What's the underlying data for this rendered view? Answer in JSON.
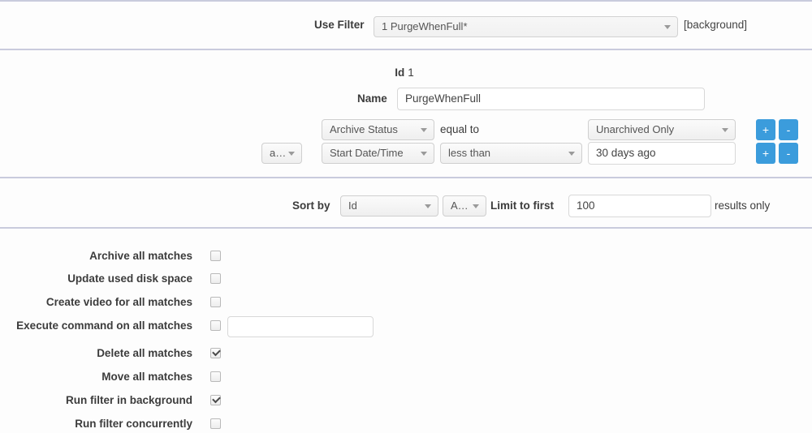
{
  "header": {
    "use_filter_label": "Use Filter",
    "use_filter_value": "1 PurgeWhenFull*",
    "background_note": "[background]"
  },
  "filter": {
    "id_label": "Id",
    "id_value": "1",
    "name_label": "Name",
    "name_value": "PurgeWhenFull",
    "name_placeholder": "",
    "conditions": [
      {
        "conjunction": "",
        "field": "Archive Status",
        "operator": "equal to",
        "operator_is_select": false,
        "value": "Unarchived Only",
        "value_is_select": true,
        "add_label": "+",
        "remove_label": "-"
      },
      {
        "conjunction": "and",
        "field": "Start Date/Time",
        "operator": "less than",
        "operator_is_select": true,
        "value": "30 days ago",
        "value_is_select": false,
        "add_label": "+",
        "remove_label": "-"
      }
    ]
  },
  "sort": {
    "sort_by_label": "Sort by",
    "sort_field": "Id",
    "sort_direction": "Asc",
    "limit_label": "Limit to first",
    "limit_value": "100",
    "limit_placeholder": "",
    "results_note": "results only"
  },
  "actions": {
    "items": [
      {
        "label": "Archive all matches",
        "checked": false
      },
      {
        "label": "Update used disk space",
        "checked": false
      },
      {
        "label": "Create video for all matches",
        "checked": false
      },
      {
        "label": "Execute command on all matches",
        "checked": false
      },
      {
        "label": "Delete all matches",
        "checked": true
      },
      {
        "label": "Move all matches",
        "checked": false
      },
      {
        "label": "Run filter in background",
        "checked": true
      },
      {
        "label": "Run filter concurrently",
        "checked": false
      }
    ],
    "command_value": "",
    "command_placeholder": ""
  },
  "colors": {
    "accent_button": "#3b9cdc",
    "divider": "#c9cbdd",
    "page_background": "#fdfdfd",
    "text": "#3c3c3c"
  }
}
